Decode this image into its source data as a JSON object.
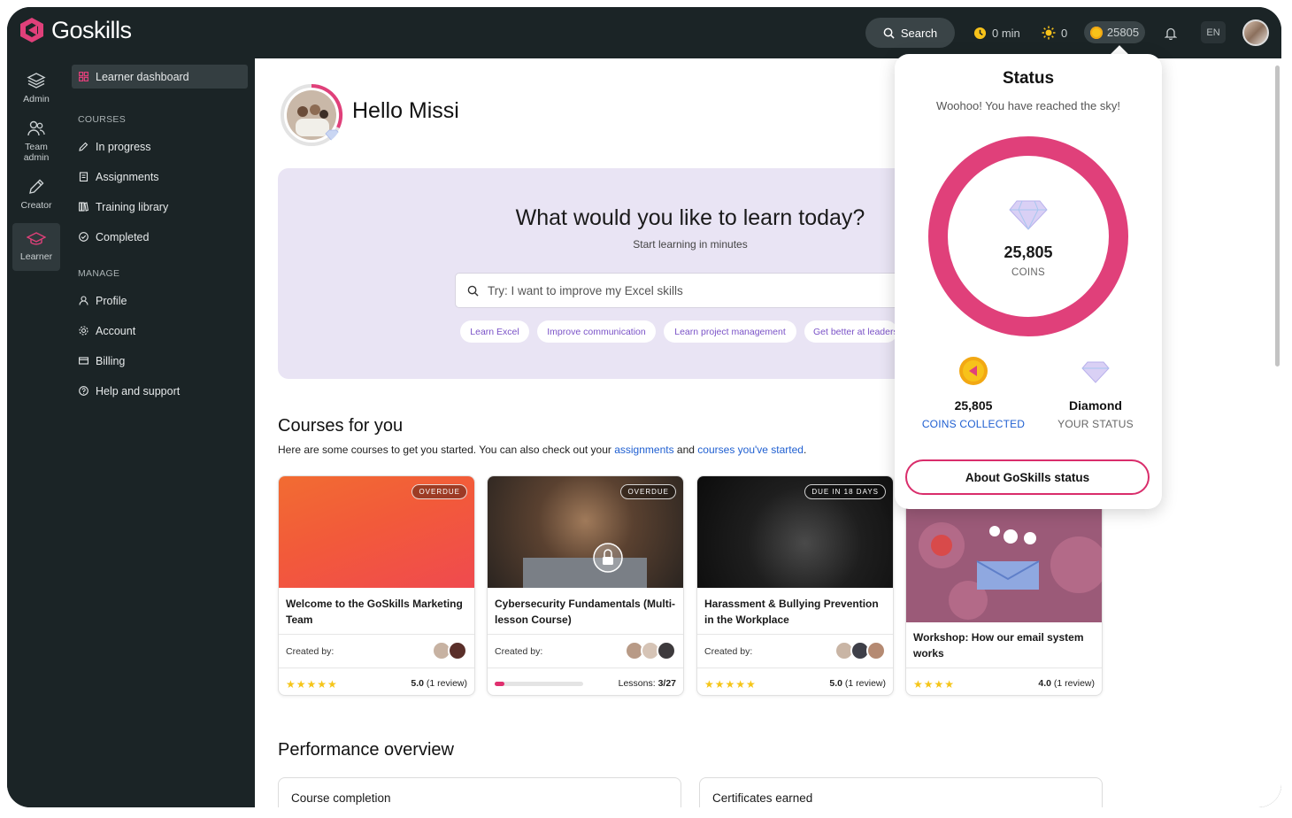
{
  "app": {
    "brand": "Goskills",
    "brand_color": "#e0407a"
  },
  "topbar": {
    "search_label": "Search",
    "time_value": "0 min",
    "streak_value": "0",
    "coins_value": "25805",
    "language": "EN"
  },
  "rail": [
    {
      "label": "Admin",
      "icon": "layers-icon"
    },
    {
      "label": "Team admin",
      "icon": "team-icon"
    },
    {
      "label": "Creator",
      "icon": "pencil-icon"
    },
    {
      "label": "Learner",
      "icon": "graduation-cap-icon"
    }
  ],
  "sidenav": {
    "dashboard": "Learner dashboard",
    "courses_heading": "COURSES",
    "courses": [
      "In progress",
      "Assignments",
      "Training library",
      "Completed"
    ],
    "manage_heading": "MANAGE",
    "manage": [
      "Profile",
      "Account",
      "Billing",
      "Help and support"
    ]
  },
  "greeting": "Hello Missi",
  "hero": {
    "title": "What would you like to learn today?",
    "subtitle": "Start learning in minutes",
    "search_placeholder": "Try: I want to improve my Excel skills",
    "chips": [
      "Learn Excel",
      "Improve communication",
      "Learn project management",
      "Get better at leadership"
    ]
  },
  "courses_section": {
    "title": "Courses for you",
    "desc_prefix": "Here are some courses to get you started. You can also check out your ",
    "link_assignments": "assignments",
    "desc_mid": " and ",
    "link_started": "courses you've started",
    "desc_suffix": "."
  },
  "courses": [
    {
      "badge": "OVERDUE",
      "title": "Welcome to the GoSkills Marketing Team",
      "created_by": "Created by:",
      "rating": "5.0",
      "reviews": "(1 review)",
      "stars": 5
    },
    {
      "badge": "OVERDUE",
      "title": "Cybersecurity Fundamentals (Multi-lesson Course)",
      "created_by": "Created by:",
      "lessons_label": "Lessons:",
      "lessons_value": "3/27",
      "progress": 0.11
    },
    {
      "badge": "DUE IN 18 DAYS",
      "title": "Harassment & Bullying Prevention in the Workplace",
      "created_by": "Created by:",
      "rating": "5.0",
      "reviews": "(1 review)",
      "stars": 5
    },
    {
      "badge": "",
      "title": "Workshop: How our email system works",
      "rating": "4.0",
      "reviews": "(1 review)",
      "stars": 4
    }
  ],
  "performance": {
    "title": "Performance overview",
    "panels": [
      "Course completion",
      "Certificates earned"
    ]
  },
  "status_popup": {
    "title": "Status",
    "subtitle": "Woohoo! You have reached the sky!",
    "coins_number": "25,805",
    "coins_label": "COINS",
    "collected_number": "25,805",
    "collected_label": "COINS COLLECTED",
    "status_name": "Diamond",
    "status_label": "YOUR STATUS",
    "button": "About GoSkills status"
  }
}
